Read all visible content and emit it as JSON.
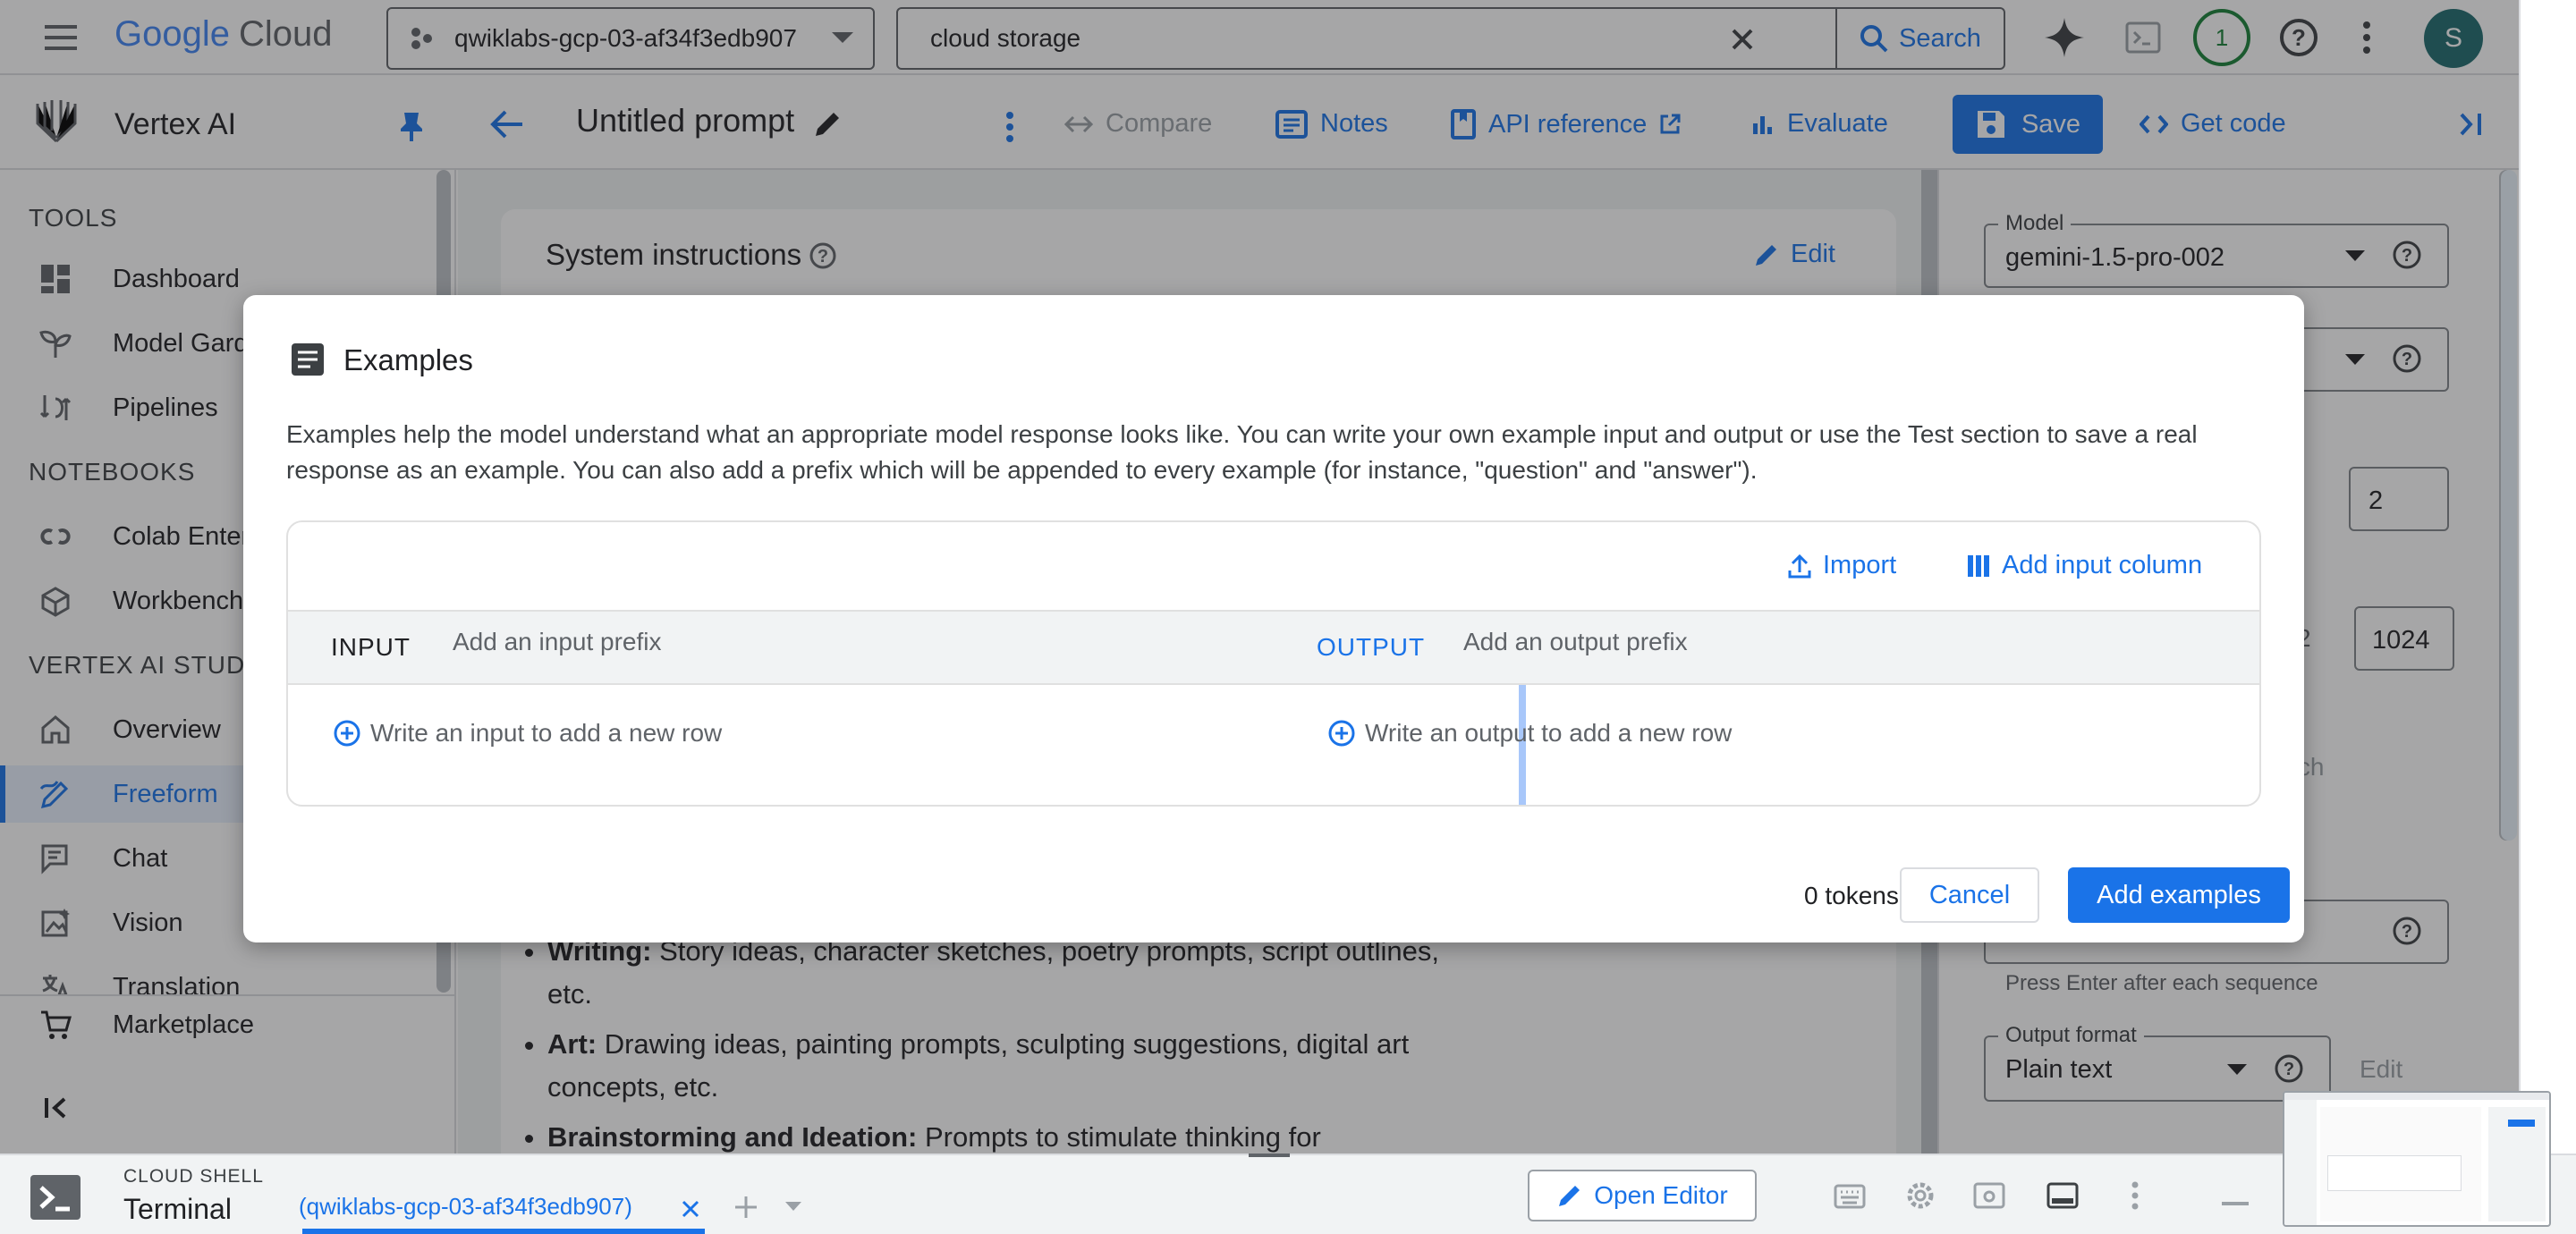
{
  "topbar": {
    "logo_google": "Google",
    "logo_cloud": "Cloud",
    "project": "qwiklabs-gcp-03-af34f3edb907",
    "search_value": "cloud storage",
    "search_label": "Search",
    "notification_count": "1",
    "avatar_letter": "S"
  },
  "vertexbar": {
    "product": "Vertex AI",
    "prompt_title": "Untitled prompt",
    "compare": "Compare",
    "notes": "Notes",
    "api_reference": "API reference",
    "evaluate": "Evaluate",
    "save": "Save",
    "get_code": "Get code"
  },
  "sidebar": {
    "sections": {
      "tools": "TOOLS",
      "notebooks": "NOTEBOOKS",
      "studio": "VERTEX AI STUDIO"
    },
    "items": [
      {
        "label": "Dashboard"
      },
      {
        "label": "Model Gard"
      },
      {
        "label": "Pipelines"
      },
      {
        "label": "Colab Enter"
      },
      {
        "label": "Workbench"
      },
      {
        "label": "Overview"
      },
      {
        "label": "Freeform"
      },
      {
        "label": "Chat"
      },
      {
        "label": "Vision"
      },
      {
        "label": "Translation"
      },
      {
        "label": "Marketplace"
      }
    ]
  },
  "main": {
    "system_instructions": "System instructions",
    "edit": "Edit",
    "bullets": [
      {
        "bold": "Writing:",
        "text": " Story ideas, character sketches, poetry prompts, script outlines, etc."
      },
      {
        "bold": "Art:",
        "text": " Drawing ideas, painting prompts, sculpting suggestions, digital art concepts, etc."
      },
      {
        "bold": "Brainstorming and Ideation:",
        "text": " Prompts to stimulate thinking for"
      }
    ]
  },
  "rightpanel": {
    "model_label": "Model",
    "model_value": "gemini-1.5-pro-002",
    "num_value_1": "2",
    "num_value_2": "1024",
    "partial_text_1": "2",
    "partial_text_2": "arch",
    "stop_hint": "Press Enter after each sequence",
    "output_format_label": "Output format",
    "output_format_value": "Plain text",
    "edit": "Edit"
  },
  "dialog": {
    "title": "Examples",
    "description": "Examples help the model understand what an appropriate model response looks like. You can write your own example input and output or use the Test section to save a real response as an example. You can also add a prefix which will be appended to every example (for instance, \"question\" and \"answer\").",
    "import": "Import",
    "add_input_column": "Add input column",
    "input_label": "INPUT",
    "input_prefix_placeholder": "Add an input prefix",
    "output_label": "OUTPUT",
    "output_prefix_placeholder": "Add an output prefix",
    "input_row_hint": "Write an input to add a new row",
    "output_row_hint": "Write an output to add a new row",
    "tokens": "0 tokens",
    "cancel": "Cancel",
    "add_examples": "Add examples"
  },
  "shell": {
    "small_title": "CLOUD SHELL",
    "title": "Terminal",
    "tab": "(qwiklabs-gcp-03-af34f3edb907)",
    "open_editor": "Open Editor"
  },
  "colors": {
    "accent": "#1a73e8",
    "overlay": "rgba(32,33,36,0.40)"
  }
}
